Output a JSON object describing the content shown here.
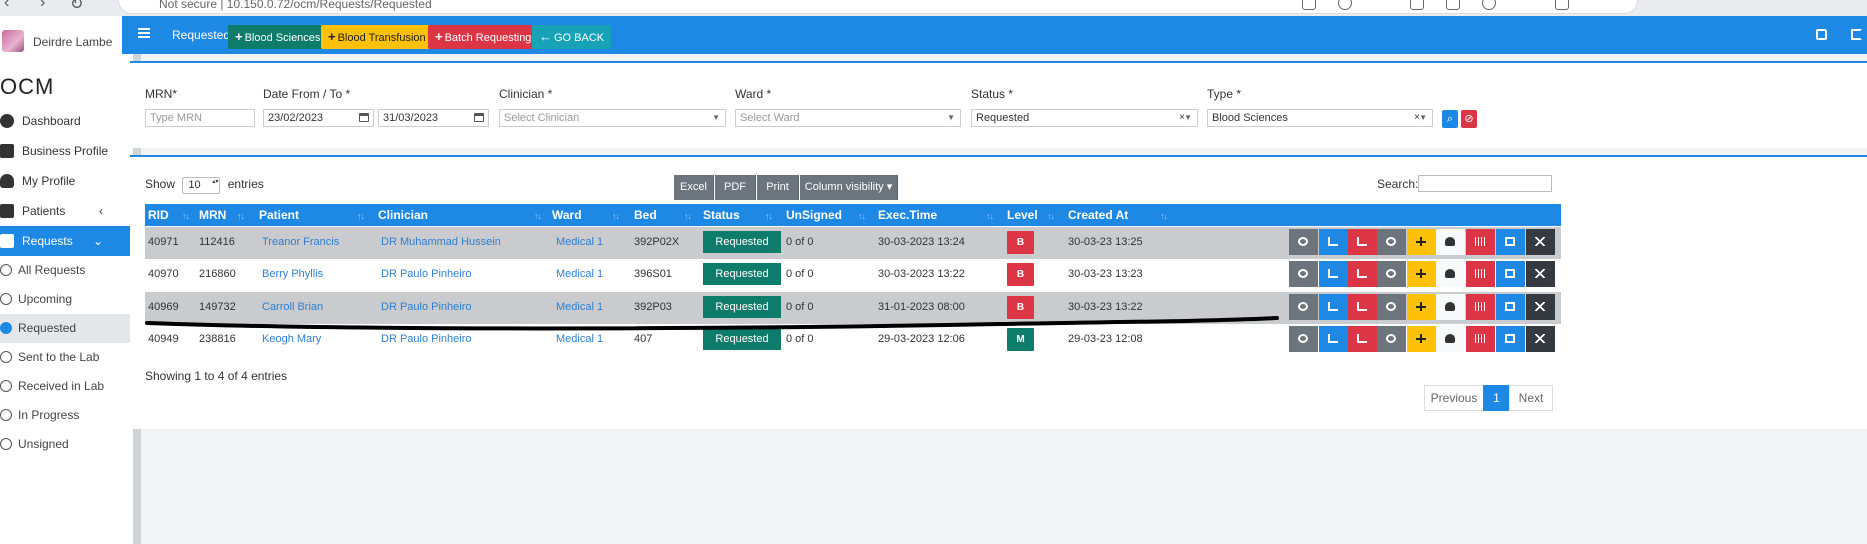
{
  "browser": {
    "url_text": "Not secure  |  10.150.0.72/ocm/Requests/Requested"
  },
  "sidebar": {
    "user_name": "Deirdre Lambe",
    "brand": "OCM",
    "items": [
      {
        "label": "Dashboard",
        "icon": "dashboard-icon"
      },
      {
        "label": "Business Profile",
        "icon": "building-icon"
      },
      {
        "label": "My Profile",
        "icon": "user-icon"
      },
      {
        "label": "Patients",
        "icon": "clipboard-icon",
        "chevron": "‹"
      },
      {
        "label": "Requests",
        "icon": "database-icon",
        "chevron": "⌄"
      }
    ],
    "subitems": [
      {
        "label": "All Requests"
      },
      {
        "label": "Upcoming"
      },
      {
        "label": "Requested"
      },
      {
        "label": "Sent to the Lab"
      },
      {
        "label": "Received in Lab"
      },
      {
        "label": "In Progress"
      },
      {
        "label": "Unsigned"
      }
    ]
  },
  "topbar": {
    "crumb": "Requested",
    "buttons": [
      {
        "label": "Blood Sciences",
        "color": "#0e7c6b"
      },
      {
        "label": "Blood Transfusion",
        "color": "#ffc107"
      },
      {
        "label": "Batch Requesting",
        "color": "#dc3545"
      },
      {
        "label": "GO BACK",
        "color": "#17a2b8"
      }
    ]
  },
  "filters": {
    "mrn": {
      "label": "MRN*",
      "placeholder": "Type MRN"
    },
    "date": {
      "label": "Date From / To *",
      "from": "23/02/2023",
      "to": "31/03/2023"
    },
    "clinician": {
      "label": "Clinician *",
      "placeholder": "Select Clinician"
    },
    "ward": {
      "label": "Ward *",
      "placeholder": "Select Ward"
    },
    "status": {
      "label": "Status *",
      "value": "Requested",
      "clear": "×"
    },
    "type": {
      "label": "Type *",
      "value": "Blood Sciences",
      "clear": "×"
    }
  },
  "table": {
    "show_label": "Show",
    "show_value": "10",
    "entries_label": "entries",
    "export_buttons": [
      "Excel",
      "PDF",
      "Print",
      "Column visibility"
    ],
    "search_label": "Search:",
    "columns": [
      "RID",
      "MRN",
      "Patient",
      "Clinician",
      "Ward",
      "Bed",
      "Status",
      "UnSigned",
      "Exec.Time",
      "Level",
      "Created At"
    ],
    "rows": [
      {
        "rid": "40971",
        "mrn": "112416",
        "patient": "Treanor Francis",
        "clinician": "DR Muhammad Hussein",
        "ward": "Medical 1",
        "bed": "392P02X",
        "status": "Requested",
        "unsigned": "0 of 0",
        "exec_time": "30-03-2023 13:24",
        "level": "B",
        "level_color": "#dc3545",
        "created_at": "30-03-23 13:25"
      },
      {
        "rid": "40970",
        "mrn": "216860",
        "patient": "Berry Phyllis",
        "clinician": "DR Paulo Pinheiro",
        "ward": "Medical 1",
        "bed": "396S01",
        "status": "Requested",
        "unsigned": "0 of 0",
        "exec_time": "30-03-2023 13:22",
        "level": "B",
        "level_color": "#dc3545",
        "created_at": "30-03-23 13:23"
      },
      {
        "rid": "40969",
        "mrn": "149732",
        "patient": "Carroll Brian",
        "clinician": "DR Paulo Pinheiro",
        "ward": "Medical 1",
        "bed": "392P03",
        "status": "Requested",
        "unsigned": "0 of 0",
        "exec_time": "31-01-2023 08:00",
        "level": "B",
        "level_color": "#dc3545",
        "created_at": "30-03-23 13:22"
      },
      {
        "rid": "40949",
        "mrn": "238816",
        "patient": "Keogh Mary",
        "clinician": "DR Paulo Pinheiro",
        "ward": "Medical 1",
        "bed": "407",
        "status": "Requested",
        "unsigned": "0 of 0",
        "exec_time": "29-03-2023 12:06",
        "level": "M",
        "level_color": "#0e7c6b",
        "created_at": "29-03-23 12:08"
      }
    ],
    "row_actions": [
      {
        "icon": "eye-icon",
        "color": "#6c757d"
      },
      {
        "icon": "bar-chart-icon",
        "color": "#1e88e5"
      },
      {
        "icon": "line-chart-icon",
        "color": "#dc3545"
      },
      {
        "icon": "wheelchair-icon",
        "color": "#6c757d"
      },
      {
        "icon": "plus-icon",
        "color": "#ffc107"
      },
      {
        "icon": "users-icon",
        "color": "#f8f9fa"
      },
      {
        "icon": "barcode-icon",
        "color": "#dc3545"
      },
      {
        "icon": "edit-icon",
        "color": "#1e88e5"
      },
      {
        "icon": "close-icon",
        "color": "#343a40"
      }
    ],
    "info": "Showing 1 to 4 of 4 entries",
    "pagination": {
      "previous": "Previous",
      "current": "1",
      "next": "Next"
    }
  }
}
